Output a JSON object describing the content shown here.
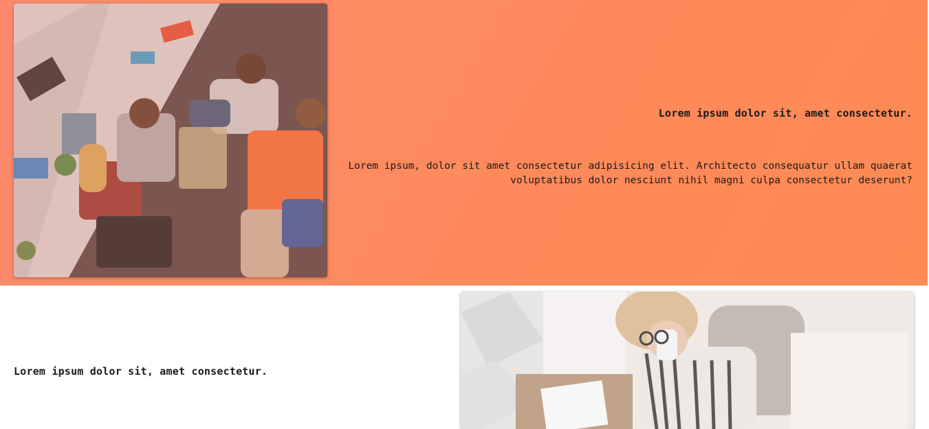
{
  "feature_top": {
    "image": "office-team-photo",
    "heading": "Lorem ipsum dolor sit, amet consectetur.",
    "text": "Lorem ipsum, dolor sit amet consectetur adipisicing elit. Architecto consequatur ullam quaerat voluptatibus dolor nesciunt nihil magni culpa consectetur deserunt?"
  },
  "feature_bottom": {
    "image": "woman-on-phone-photo",
    "heading": "Lorem ipsum dolor sit, amet consectetur."
  },
  "colors": {
    "accent_gradient_start": "#fd8a6e",
    "accent_gradient_end": "#fe8b54",
    "text": "#1a1a1a",
    "background": "#ffffff"
  }
}
